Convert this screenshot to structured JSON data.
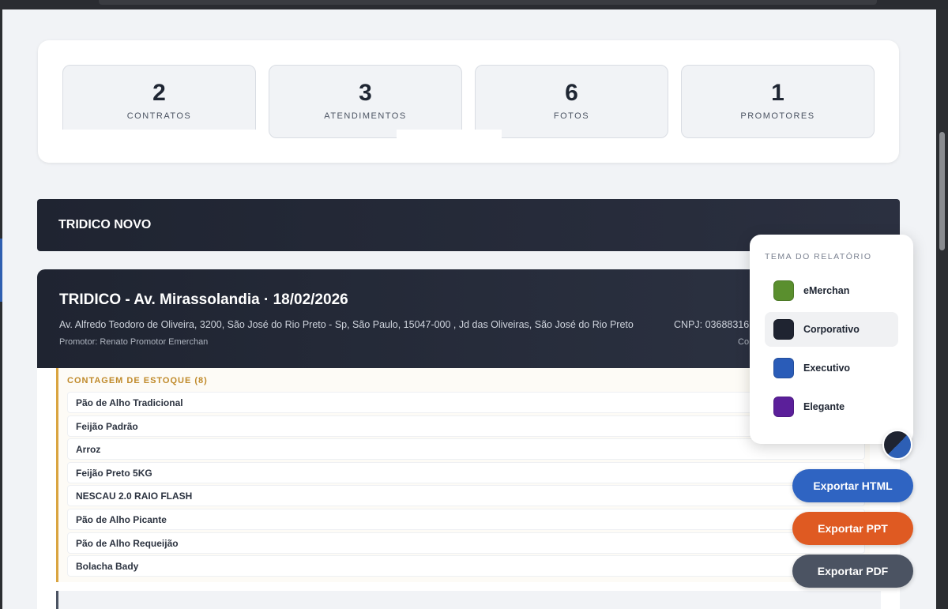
{
  "stats": [
    {
      "value": "2",
      "label": "CONTRATOS"
    },
    {
      "value": "3",
      "label": "ATENDIMENTOS"
    },
    {
      "value": "6",
      "label": "FOTOS"
    },
    {
      "value": "1",
      "label": "PROMOTORES"
    }
  ],
  "group": {
    "title": "TRIDICO NOVO"
  },
  "store": {
    "title": "TRIDICO - Av. Mirassolandia · 18/02/2026",
    "address": "Av. Alfredo Teodoro de Oliveira, 3200, São José do Rio Preto - Sp, São Paulo, 15047-000 , Jd das Oliveiras, São José do Rio Preto",
    "cnpj": "CNPJ: 03688316",
    "promoter": "Promotor: Renato Promotor Emerchan",
    "co_partial": "Co"
  },
  "stock": {
    "title": "CONTAGEM DE ESTOQUE (8)",
    "items": [
      "Pão de Alho Tradicional",
      "Feijão Padrão",
      "Arroz",
      "Feijão Preto 5KG",
      "NESCAU 2.0 RAIO FLASH",
      "Pão de Alho Picante",
      "Pão de Alho Requeijão",
      "Bolacha Bady"
    ]
  },
  "theme_panel": {
    "title": "TEMA DO RELATÓRIO",
    "options": [
      {
        "name": "eMerchan",
        "color": "#5a8f2e",
        "active": false
      },
      {
        "name": "Corporativo",
        "color": "#1f2431",
        "active": true
      },
      {
        "name": "Executivo",
        "color": "#2a5cb8",
        "active": false
      },
      {
        "name": "Elegante",
        "color": "#5b1f9a",
        "active": false
      }
    ]
  },
  "exports": {
    "html": {
      "label": "Exportar HTML",
      "color": "#2f64c2"
    },
    "ppt": {
      "label": "Exportar PPT",
      "color": "#df5a22"
    },
    "pdf": {
      "label": "Exportar PDF",
      "color": "#4b5362"
    }
  }
}
